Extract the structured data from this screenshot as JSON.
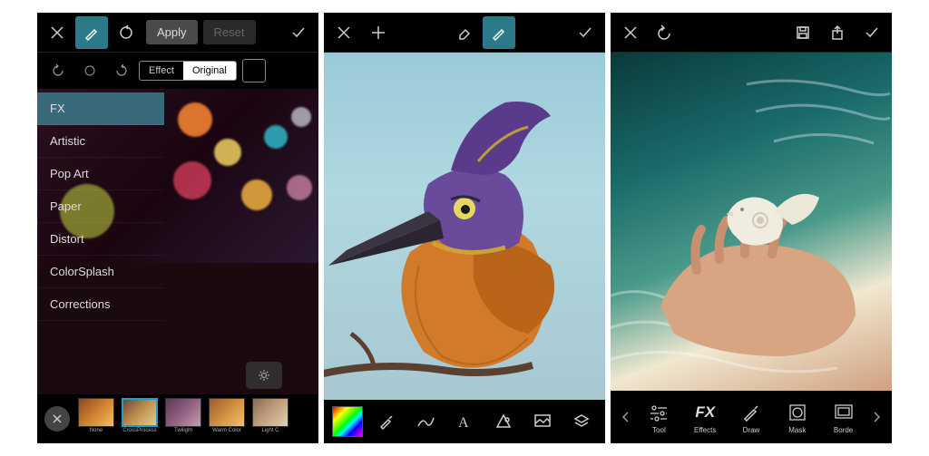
{
  "screen1": {
    "apply": "Apply",
    "reset": "Reset",
    "effect": "Effect",
    "original": "Original",
    "categories": [
      "FX",
      "Artistic",
      "Pop Art",
      "Paper",
      "Distort",
      "ColorSplash",
      "Corrections"
    ],
    "selected_category": "FX",
    "filters": [
      "None",
      "CrossProcess",
      "Twilight",
      "Warm Color",
      "Light C"
    ],
    "selected_filter": "CrossProcess"
  },
  "screen3": {
    "tools": [
      "Tool",
      "Effects",
      "Draw",
      "Mask",
      "Borde"
    ]
  }
}
